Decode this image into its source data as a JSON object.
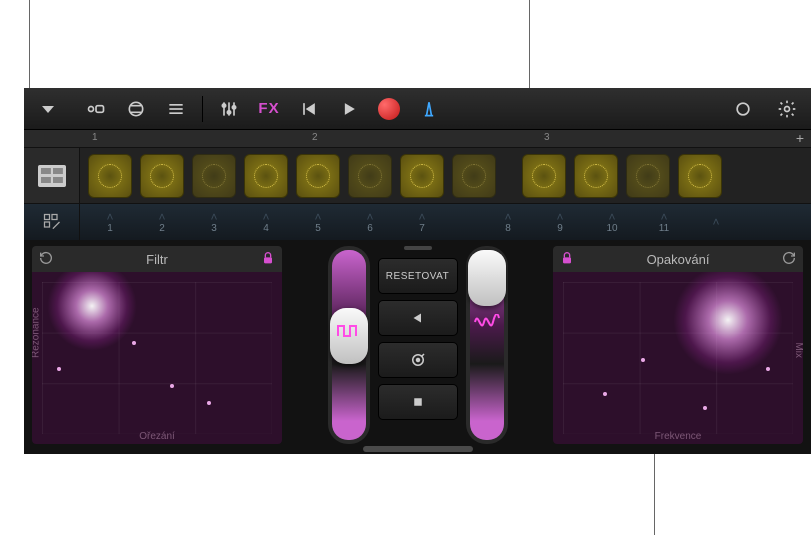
{
  "toolbar": {
    "fx_label": "FX"
  },
  "ruler": {
    "marks": [
      "1",
      "2",
      "3"
    ]
  },
  "pad_numbers": [
    "1",
    "2",
    "3",
    "4",
    "5",
    "6",
    "7",
    "8",
    "9",
    "10",
    "11"
  ],
  "fx_left": {
    "title": "Filtr",
    "y_axis": "Rezonance",
    "x_axis": "Ořezání"
  },
  "fx_right": {
    "title": "Opakování",
    "y_axis": "Mix",
    "x_axis": "Frekvence"
  },
  "center": {
    "reset_label": "RESETOVAT"
  }
}
